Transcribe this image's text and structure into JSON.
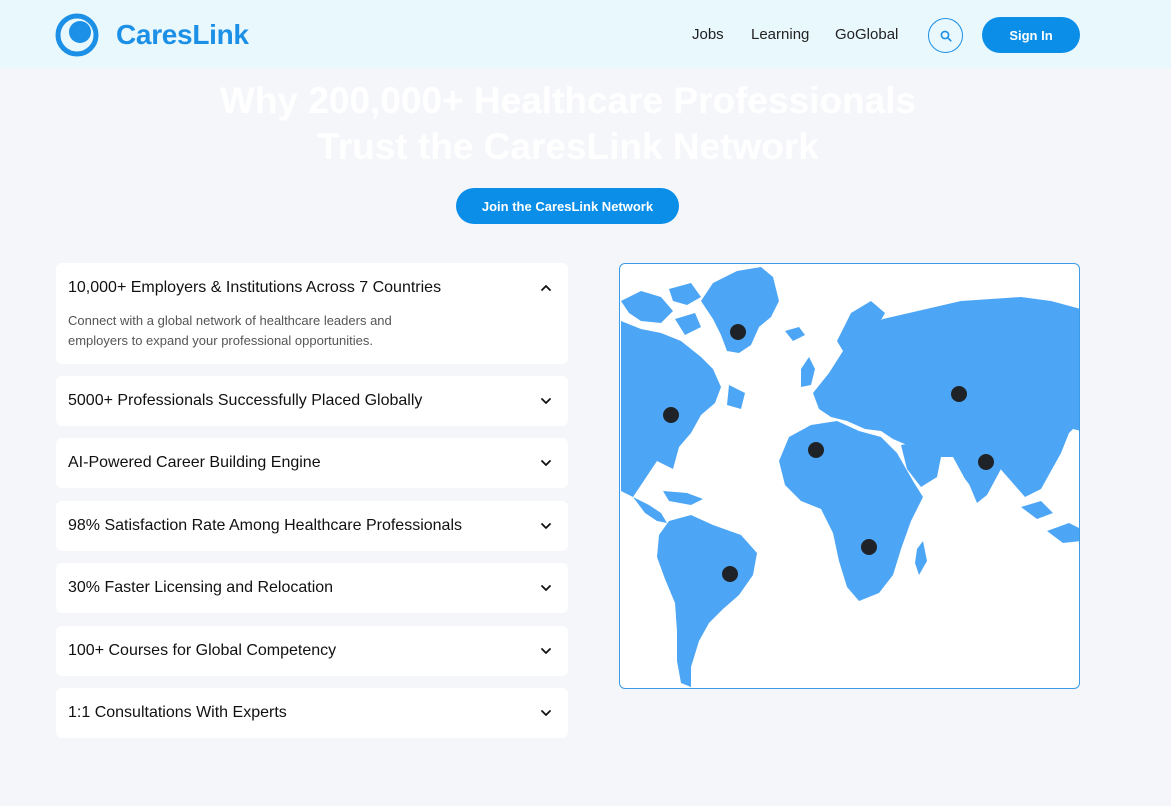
{
  "header": {
    "brand": "CaresLink",
    "nav": [
      "Jobs",
      "Learning",
      "GoGlobal"
    ],
    "signin_label": "Sign In"
  },
  "hero": {
    "title_line1": "Why 200,000+ Healthcare Professionals",
    "title_line2": "Trust the CaresLink Network",
    "cta_label": "Join the CaresLink Network"
  },
  "accordion": [
    {
      "title": "10,000+ Employers & Institutions Across 7 Countries",
      "expanded": true,
      "description_line1": "Connect with a global network of healthcare leaders and",
      "description_line2": "employers to expand your professional opportunities."
    },
    {
      "title": "5000+ Professionals Successfully Placed Globally",
      "expanded": false
    },
    {
      "title": "AI-Powered Career Building Engine",
      "expanded": false
    },
    {
      "title": "98% Satisfaction Rate Among Healthcare Professionals",
      "expanded": false
    },
    {
      "title": "30% Faster Licensing and Relocation",
      "expanded": false
    },
    {
      "title": "100+ Courses for Global Competency",
      "expanded": false
    },
    {
      "title": "1:1 Consultations With Experts",
      "expanded": false
    }
  ],
  "colors": {
    "brand": "#1c8fe6",
    "button": "#0a8ee8",
    "header_bg": "#e8f8fd",
    "page_bg": "#f4f6fa",
    "land": "#4da6f5",
    "marker": "#1f2328"
  }
}
